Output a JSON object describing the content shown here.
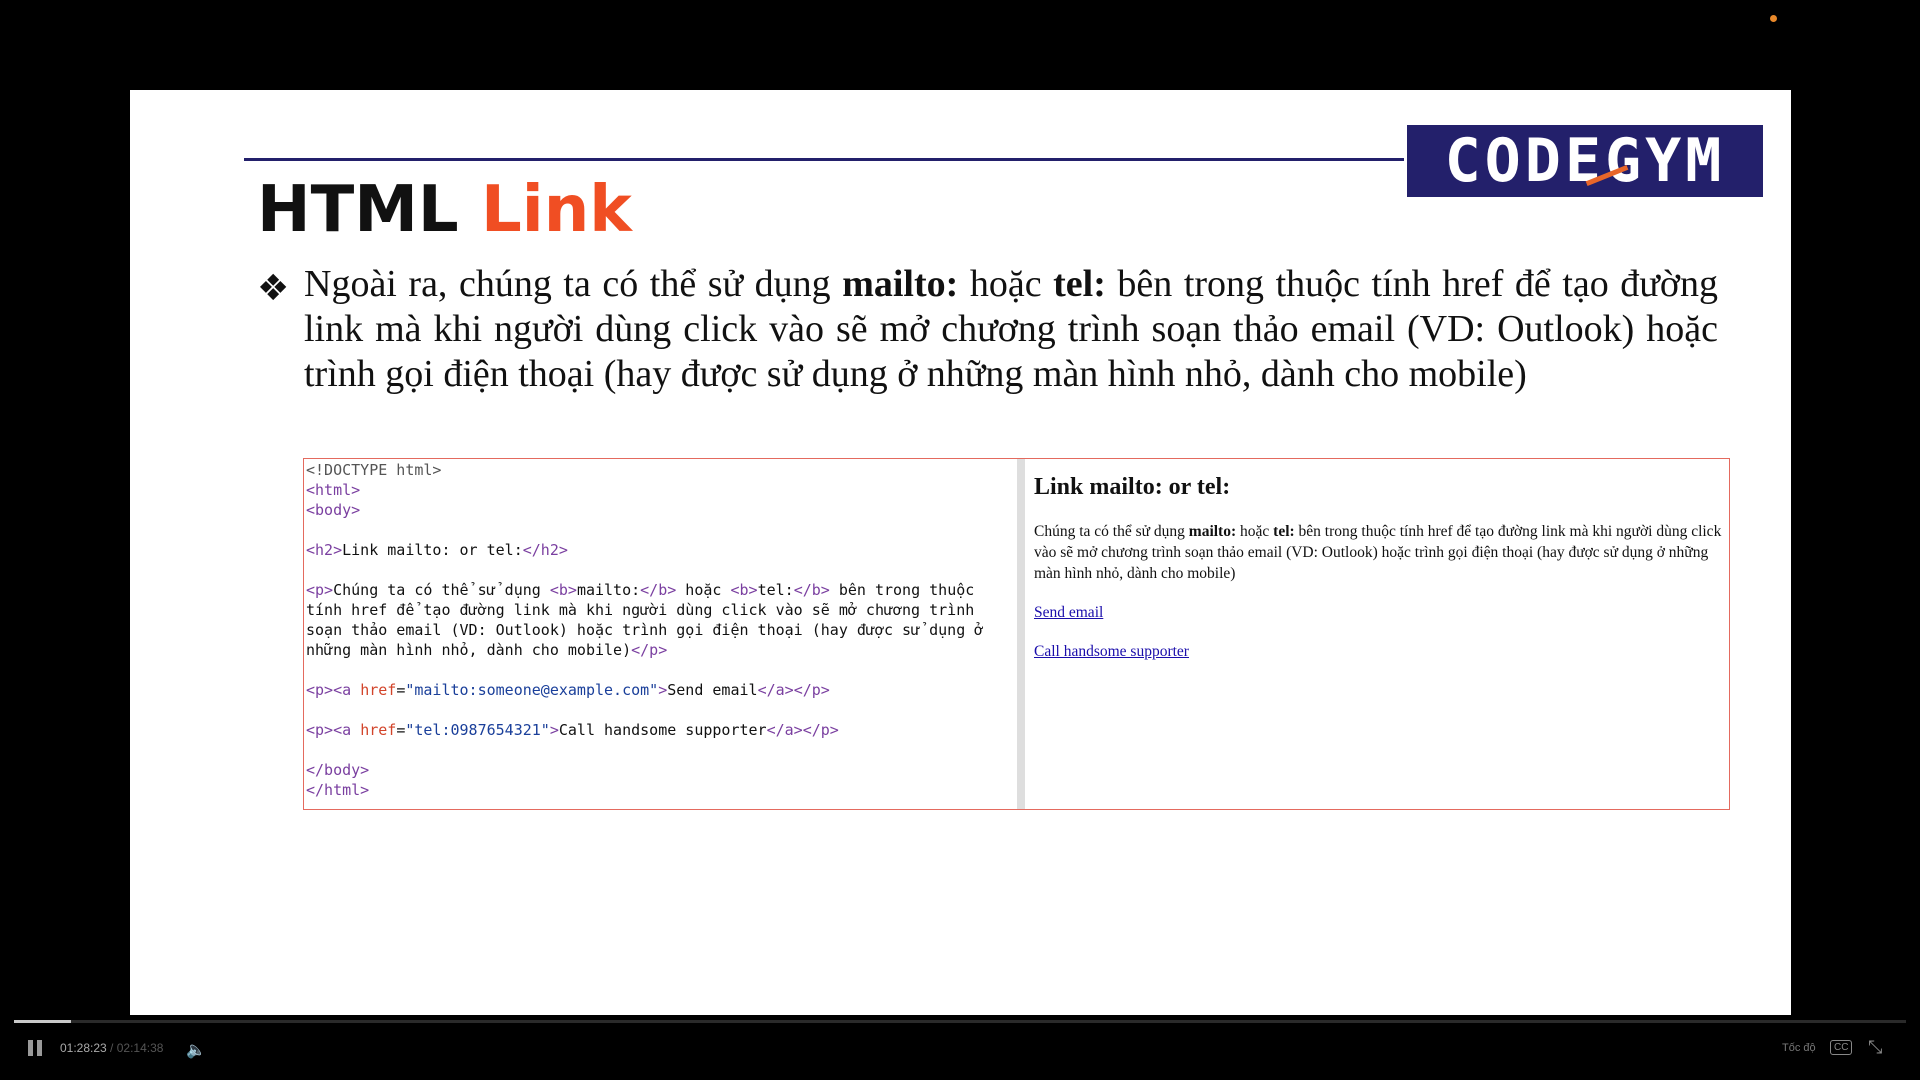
{
  "slide": {
    "logo_text": "CODEGYM",
    "title_part1": "HTML",
    "title_part2": "Link",
    "bullet_symbol": "❖",
    "bullet_pre": "Ngoài ra, chúng ta có thể sử dụng ",
    "bullet_bold1": "mailto:",
    "bullet_mid": " hoặc ",
    "bullet_bold2": "tel:",
    "bullet_post": " bên trong thuộc tính href để tạo đường link mà khi người dùng click vào sẽ mở chương trình soạn thảo email (VD: Outlook) hoặc trình gọi điện thoại (hay được sử dụng ở những màn hình nhỏ, dành cho mobile)",
    "accent_color": "#f04e23",
    "brand_color": "#23206b"
  },
  "code": {
    "doctype": "<!DOCTYPE html>",
    "html_open": "<html>",
    "body_open": "<body>",
    "h2_open": "<h2>",
    "h2_text": "Link mailto: or tel:",
    "h2_close": "</h2>",
    "p_open": "<p>",
    "p_text1": "Chúng ta có thể sử dụng ",
    "b_open": "<b>",
    "b1_text": "mailto:",
    "b_close": "</b>",
    "p_text2": " hoặc ",
    "b2_text": "tel:",
    "p_text3": " bên trong thuộc tính href để tạo đường link mà khi người dùng click vào sẽ mở chương trình soạn thảo email (VD: Outlook) hoặc trình gọi điện thoại (hay được sử dụng ở những màn hình nhỏ, dành cho mobile)",
    "p_close": "</p>",
    "a_open": "<a",
    "href_attr": "href",
    "eq": "=",
    "mail_href": "\"mailto:someone@example.com\"",
    "gt": ">",
    "mail_text": "Send email",
    "a_close": "</a>",
    "tel_href": "\"tel:0987654321\"",
    "tel_text": "Call handsome supporter",
    "body_close": "</body>",
    "html_close": "</html>"
  },
  "preview": {
    "heading": "Link mailto: or tel:",
    "desc_pre": "Chúng ta có thể sử dụng ",
    "desc_bold1": "mailto:",
    "desc_mid": " hoặc ",
    "desc_bold2": "tel:",
    "desc_post": " bên trong thuộc tính href để tạo đường link mà khi người dùng click vào sẽ mở chương trình soạn thảo email (VD: Outlook) hoặc trình gọi điện thoại (hay được sử dụng ở những màn hình nhỏ, dành cho mobile)",
    "mail_link": "Send email",
    "tel_link": "Call handsome supporter",
    "link_color": "#1a0dab"
  },
  "player": {
    "current_time": "01:28:23",
    "separator": " / ",
    "total_time": "02:14:38",
    "speed_label": "Tốc độ",
    "cc_label": "CC",
    "progress_fraction": 0.03,
    "play_state": "pause-icon",
    "volume_icon": "volume-icon",
    "fullscreen_icon": "exit-fullscreen-icon"
  }
}
